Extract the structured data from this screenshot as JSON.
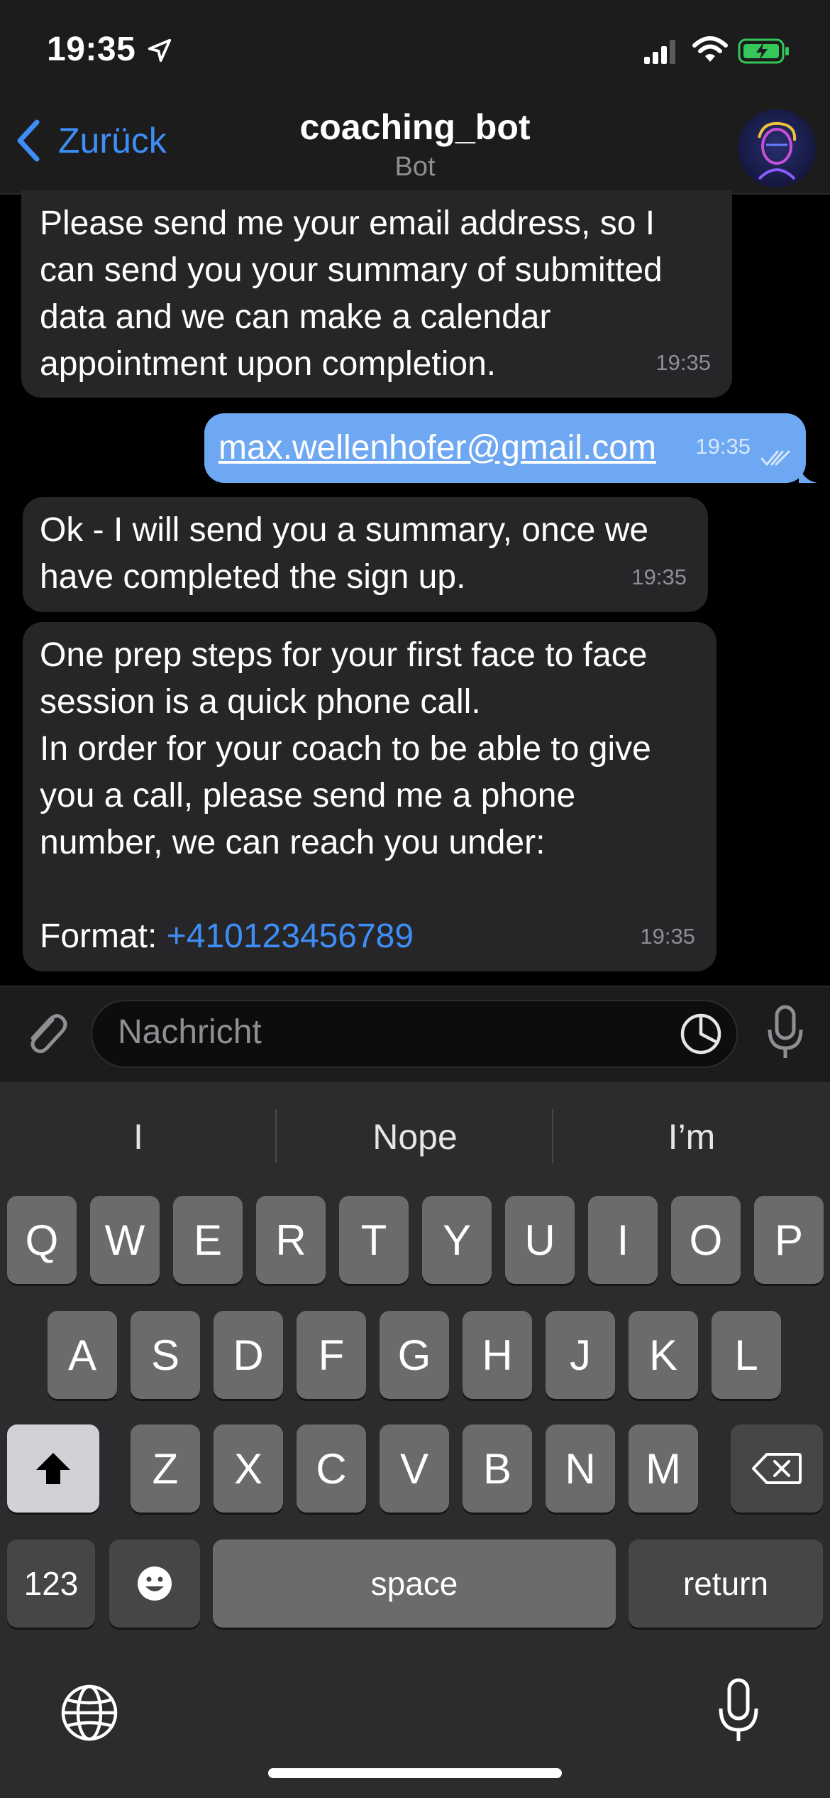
{
  "status_bar": {
    "time": "19:35"
  },
  "header": {
    "back_label": "Zurück",
    "title": "coaching_bot",
    "subtitle": "Bot"
  },
  "messages": [
    {
      "direction": "incoming",
      "text": "Please send me your email address, so I\ncan send you your summary of submitted\ndata and we can make a calendar\nappointment upon completion.",
      "time": "19:35"
    },
    {
      "direction": "outgoing",
      "text": "max.wellenhofer@gmail.com",
      "time": "19:35"
    },
    {
      "direction": "incoming",
      "text": "Ok - I will send you a summary, once we\nhave completed the sign up.",
      "time": "19:35"
    },
    {
      "direction": "incoming",
      "text": "One prep steps for your first face to face\nsession is a quick phone call.\nIn order for your coach to be able to give\nyou a call, please send me a phone\nnumber, we can reach you under:\n\nFormat: ",
      "link": "+410123456789",
      "time": "19:35"
    }
  ],
  "input": {
    "placeholder": "Nachricht"
  },
  "keyboard": {
    "suggestions": [
      "I",
      "Nope",
      "I’m"
    ],
    "row1": [
      "Q",
      "W",
      "E",
      "R",
      "T",
      "Y",
      "U",
      "I",
      "O",
      "P"
    ],
    "row2": [
      "A",
      "S",
      "D",
      "F",
      "G",
      "H",
      "J",
      "K",
      "L"
    ],
    "row3": [
      "Z",
      "X",
      "C",
      "V",
      "B",
      "N",
      "M"
    ],
    "numbers_label": "123",
    "space_label": "space",
    "return_label": "return"
  },
  "colors": {
    "accent": "#3e8ef7",
    "outgoing_bubble": "#6ea7f2",
    "incoming_bubble": "#262628",
    "background": "#000000"
  }
}
